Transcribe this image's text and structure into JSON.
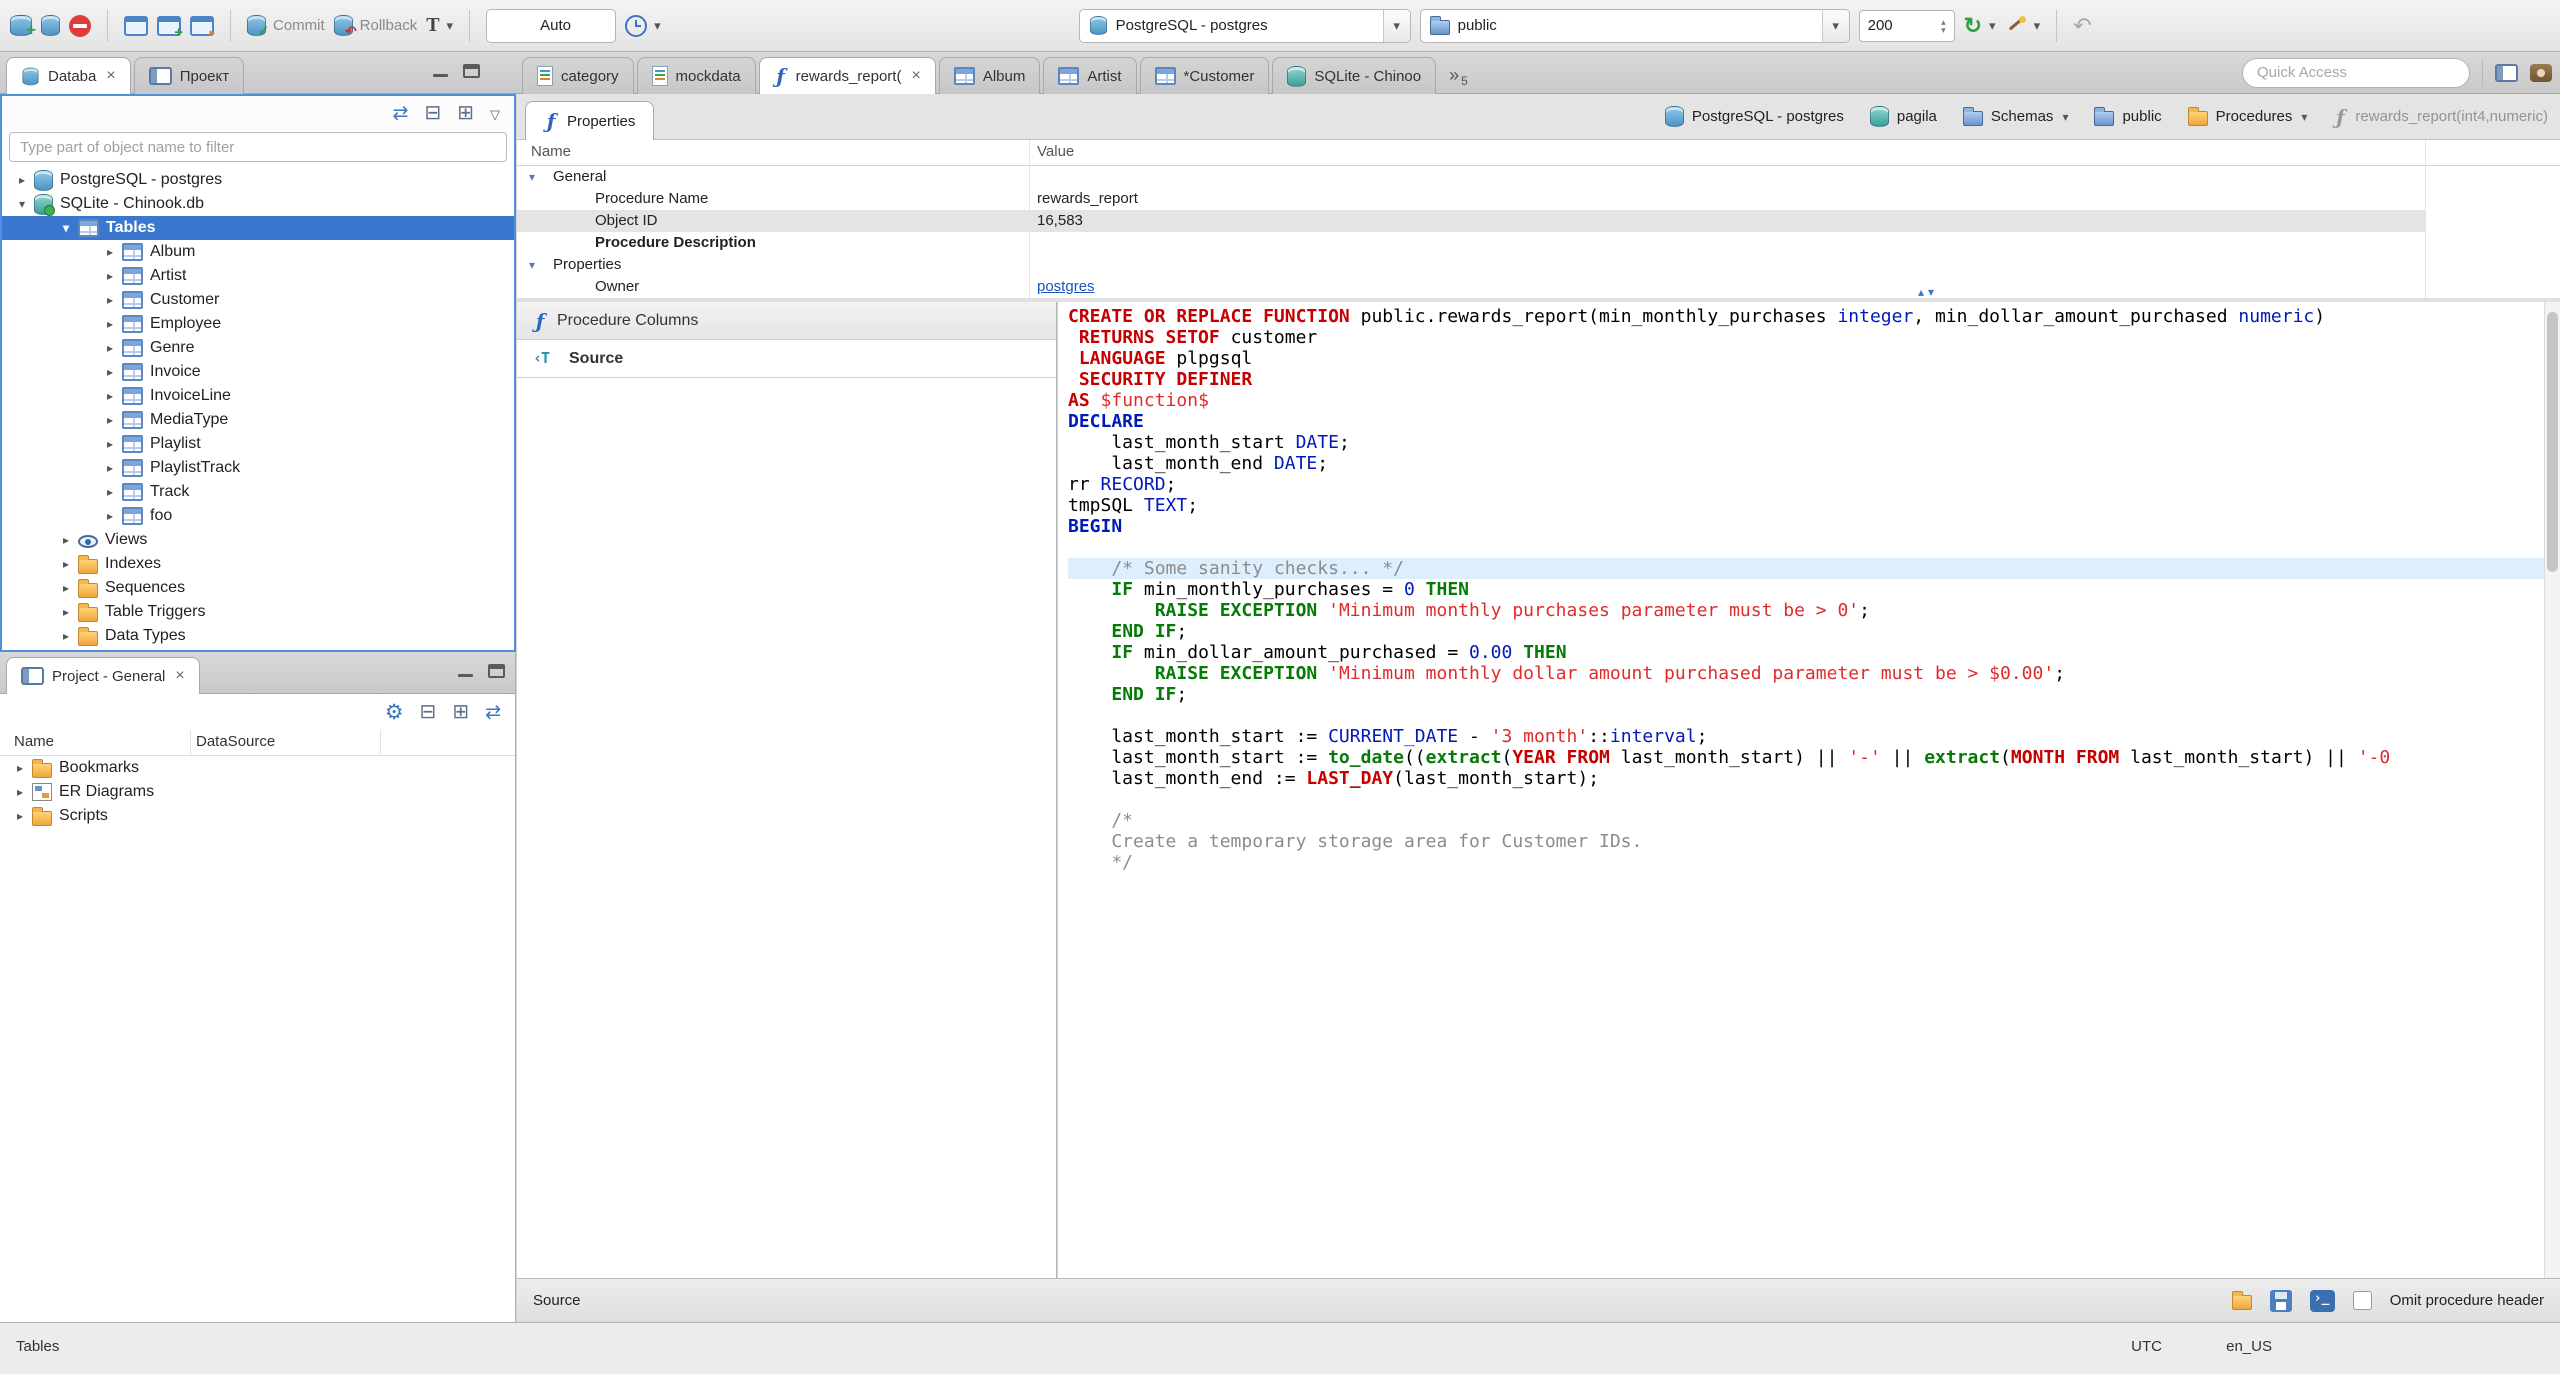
{
  "toolbar": {
    "commit_label": "Commit",
    "rollback_label": "Rollback",
    "auto_label": "Auto",
    "db_combo_value": "PostgreSQL - postgres",
    "schema_combo_value": "public",
    "fetch_size": "200",
    "quick_access_placeholder": "Quick Access"
  },
  "left": {
    "tabs": [
      {
        "label": "Databa"
      },
      {
        "label": "Проект"
      }
    ],
    "filter_placeholder": "Type part of object name to filter",
    "tree": [
      {
        "label": "PostgreSQL - postgres",
        "level": 0,
        "icon": "database-postgres",
        "expander": "collapsed"
      },
      {
        "label": "SQLite - Chinook.db",
        "level": 0,
        "icon": "database-sqlite",
        "expander": "expanded"
      },
      {
        "label": "Tables",
        "level": 1,
        "icon": "table-folder",
        "expander": "expanded",
        "selected": true
      },
      {
        "label": "Album",
        "level": 2,
        "icon": "table",
        "expander": "collapsed"
      },
      {
        "label": "Artist",
        "level": 2,
        "icon": "table",
        "expander": "collapsed"
      },
      {
        "label": "Customer",
        "level": 2,
        "icon": "table",
        "expander": "collapsed"
      },
      {
        "label": "Employee",
        "level": 2,
        "icon": "table",
        "expander": "collapsed"
      },
      {
        "label": "Genre",
        "level": 2,
        "icon": "table",
        "expander": "collapsed"
      },
      {
        "label": "Invoice",
        "level": 2,
        "icon": "table",
        "expander": "collapsed"
      },
      {
        "label": "InvoiceLine",
        "level": 2,
        "icon": "table",
        "expander": "collapsed"
      },
      {
        "label": "MediaType",
        "level": 2,
        "icon": "table",
        "expander": "collapsed"
      },
      {
        "label": "Playlist",
        "level": 2,
        "icon": "table",
        "expander": "collapsed"
      },
      {
        "label": "PlaylistTrack",
        "level": 2,
        "icon": "table",
        "expander": "collapsed"
      },
      {
        "label": "Track",
        "level": 2,
        "icon": "table",
        "expander": "collapsed"
      },
      {
        "label": "foo",
        "level": 2,
        "icon": "table",
        "expander": "collapsed"
      },
      {
        "label": "Views",
        "level": 1,
        "icon": "views",
        "expander": "collapsed"
      },
      {
        "label": "Indexes",
        "level": 1,
        "icon": "folder",
        "expander": "collapsed"
      },
      {
        "label": "Sequences",
        "level": 1,
        "icon": "folder",
        "expander": "collapsed"
      },
      {
        "label": "Table Triggers",
        "level": 1,
        "icon": "folder",
        "expander": "collapsed"
      },
      {
        "label": "Data Types",
        "level": 1,
        "icon": "folder",
        "expander": "collapsed"
      }
    ],
    "project": {
      "tab_label": "Project - General",
      "columns": [
        "Name",
        "DataSource"
      ],
      "items": [
        {
          "label": "Bookmarks",
          "icon": "folder-bookmarks"
        },
        {
          "label": "ER Diagrams",
          "icon": "er"
        },
        {
          "label": "Scripts",
          "icon": "folder-scripts"
        }
      ]
    }
  },
  "editor": {
    "tabs": [
      {
        "label": "category",
        "icon": "sql"
      },
      {
        "label": "mockdata",
        "icon": "sql"
      },
      {
        "label": "rewards_report(",
        "icon": "function",
        "active": true,
        "closable": true
      },
      {
        "label": "Album",
        "icon": "table"
      },
      {
        "label": "Artist",
        "icon": "table"
      },
      {
        "label": "*Customer",
        "icon": "table"
      },
      {
        "label": "SQLite - Chinoo",
        "icon": "database-teal"
      }
    ],
    "tab_overflow_count": "5",
    "properties_tab_label": "Properties",
    "breadcrumb": [
      {
        "label": "PostgreSQL - postgres",
        "icon": "database"
      },
      {
        "label": "pagila",
        "icon": "database-teal"
      },
      {
        "label": "Schemas",
        "icon": "schema",
        "caret": true
      },
      {
        "label": "public",
        "icon": "schema"
      },
      {
        "label": "Procedures",
        "icon": "folder",
        "caret": true
      },
      {
        "label": "rewards_report(int4,numeric)",
        "icon": "function-gray",
        "muted": true
      }
    ],
    "grid": {
      "name_header": "Name",
      "value_header": "Value",
      "rows": [
        {
          "name": "General",
          "group": true
        },
        {
          "name": "Procedure Name",
          "value": "rewards_report"
        },
        {
          "name": "Object ID",
          "value": "16,583",
          "selected": true
        },
        {
          "name": "Procedure Description",
          "bold": true
        },
        {
          "name": "Properties",
          "group": true
        },
        {
          "name": "Owner",
          "value": "postgres",
          "link": true
        }
      ]
    },
    "subtabs": [
      {
        "label": "Procedure Columns",
        "icon": "function"
      },
      {
        "label": "Source",
        "icon": "source",
        "selected": true
      }
    ],
    "code": {
      "active_line": 12,
      "lines": [
        [
          [
            "k",
            "CREATE OR REPLACE FUNCTION"
          ],
          [
            "p",
            " public.rewards_report(min_monthly_purchases "
          ],
          [
            "t",
            "integer"
          ],
          [
            "p",
            ", min_dollar_amount_purchased "
          ],
          [
            "t",
            "numeric"
          ],
          [
            "p",
            ")"
          ]
        ],
        [
          [
            "p",
            " "
          ],
          [
            "k",
            "RETURNS SETOF"
          ],
          [
            "p",
            " customer"
          ]
        ],
        [
          [
            "p",
            " "
          ],
          [
            "k",
            "LANGUAGE"
          ],
          [
            "p",
            " plpgsql"
          ]
        ],
        [
          [
            "p",
            " "
          ],
          [
            "k",
            "SECURITY DEFINER"
          ]
        ],
        [
          [
            "k",
            "AS"
          ],
          [
            "p",
            " "
          ],
          [
            "s",
            "$function$"
          ]
        ],
        [
          [
            "b",
            "DECLARE"
          ]
        ],
        [
          [
            "p",
            "    last_month_start "
          ],
          [
            "t",
            "DATE"
          ],
          [
            "p",
            ";"
          ]
        ],
        [
          [
            "p",
            "    last_month_end "
          ],
          [
            "t",
            "DATE"
          ],
          [
            "p",
            ";"
          ]
        ],
        [
          [
            "p",
            "rr "
          ],
          [
            "t",
            "RECORD"
          ],
          [
            "p",
            ";"
          ]
        ],
        [
          [
            "p",
            "tmpSQL "
          ],
          [
            "t",
            "TEXT"
          ],
          [
            "p",
            ";"
          ]
        ],
        [
          [
            "b",
            "BEGIN"
          ]
        ],
        [],
        [
          [
            "c",
            "    /* Some sanity checks... */"
          ]
        ],
        [
          [
            "p",
            "    "
          ],
          [
            "g",
            "IF"
          ],
          [
            "p",
            " min_monthly_purchases = "
          ],
          [
            "n",
            "0"
          ],
          [
            "p",
            " "
          ],
          [
            "g",
            "THEN"
          ]
        ],
        [
          [
            "p",
            "        "
          ],
          [
            "g",
            "RAISE EXCEPTION"
          ],
          [
            "p",
            " "
          ],
          [
            "s",
            "'Minimum monthly purchases parameter must be > 0'"
          ],
          [
            "p",
            ";"
          ]
        ],
        [
          [
            "p",
            "    "
          ],
          [
            "g",
            "END IF"
          ],
          [
            "p",
            ";"
          ]
        ],
        [
          [
            "p",
            "    "
          ],
          [
            "g",
            "IF"
          ],
          [
            "p",
            " min_dollar_amount_purchased = "
          ],
          [
            "n",
            "0.00"
          ],
          [
            "p",
            " "
          ],
          [
            "g",
            "THEN"
          ]
        ],
        [
          [
            "p",
            "        "
          ],
          [
            "g",
            "RAISE EXCEPTION"
          ],
          [
            "p",
            " "
          ],
          [
            "s",
            "'Minimum monthly dollar amount purchased parameter must be > $0.00'"
          ],
          [
            "p",
            ";"
          ]
        ],
        [
          [
            "p",
            "    "
          ],
          [
            "g",
            "END IF"
          ],
          [
            "p",
            ";"
          ]
        ],
        [],
        [
          [
            "p",
            "    last_month_start := "
          ],
          [
            "t",
            "CURRENT_DATE"
          ],
          [
            "p",
            " - "
          ],
          [
            "s",
            "'3 month'"
          ],
          [
            "p",
            "::"
          ],
          [
            "t",
            "interval"
          ],
          [
            "p",
            ";"
          ]
        ],
        [
          [
            "p",
            "    last_month_start := "
          ],
          [
            "g",
            "to_date"
          ],
          [
            "p",
            "(("
          ],
          [
            "g",
            "extract"
          ],
          [
            "p",
            "("
          ],
          [
            "k",
            "YEAR FROM"
          ],
          [
            "p",
            " last_month_start) || "
          ],
          [
            "s",
            "'-'"
          ],
          [
            "p",
            " || "
          ],
          [
            "g",
            "extract"
          ],
          [
            "p",
            "("
          ],
          [
            "k",
            "MONTH FROM"
          ],
          [
            "p",
            " last_month_start) || "
          ],
          [
            "s",
            "'-0"
          ]
        ],
        [
          [
            "p",
            "    last_month_end := "
          ],
          [
            "k",
            "LAST_DAY"
          ],
          [
            "p",
            "(last_month_start);"
          ]
        ],
        [],
        [
          [
            "c",
            "    /*"
          ]
        ],
        [
          [
            "c",
            "    Create a temporary storage area for Customer IDs."
          ]
        ],
        [
          [
            "c",
            "    */"
          ]
        ]
      ]
    },
    "bottom": {
      "source_label": "Source",
      "checkbox_label": "Omit procedure header"
    }
  },
  "statusbar": {
    "left_label": "Tables",
    "timezone": "UTC",
    "locale": "en_US"
  }
}
